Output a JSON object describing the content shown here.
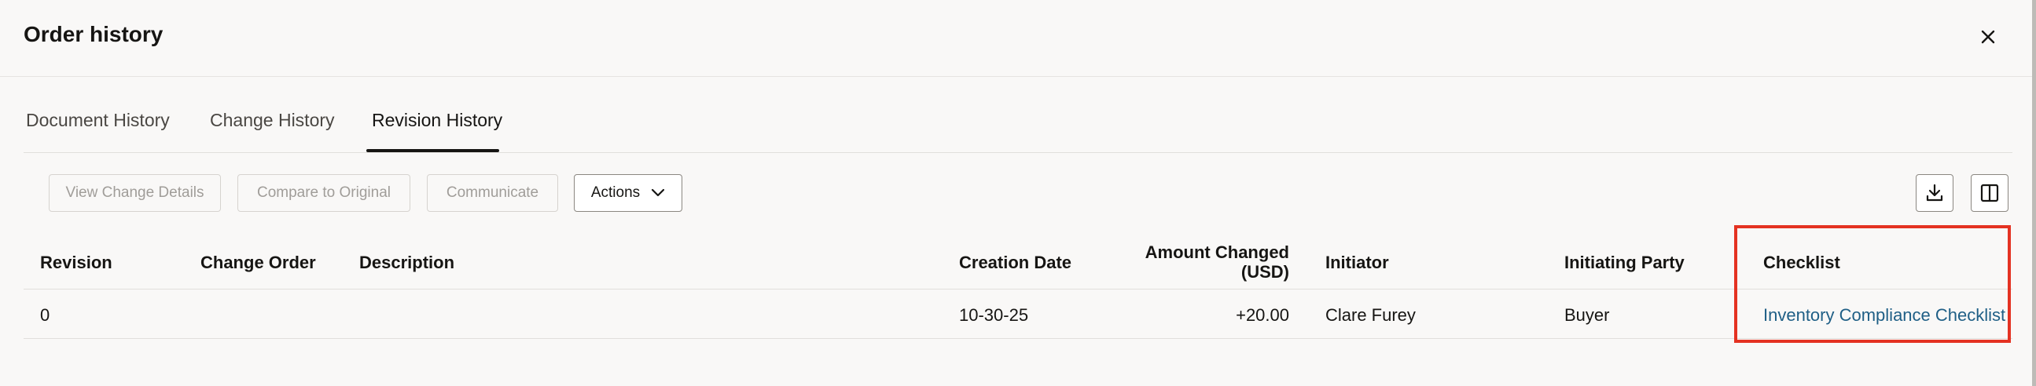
{
  "dialog": {
    "title": "Order history"
  },
  "tabs": [
    {
      "label": "Document History"
    },
    {
      "label": "Change History"
    },
    {
      "label": "Revision History",
      "active": true
    }
  ],
  "toolbar": {
    "view_change_details": "View Change Details",
    "compare_to_original": "Compare to Original",
    "communicate": "Communicate",
    "actions": "Actions"
  },
  "table": {
    "columns": {
      "revision": "Revision",
      "change_order": "Change Order",
      "description": "Description",
      "creation_date": "Creation Date",
      "amount_line1": "Amount Changed",
      "amount_line2": "(USD)",
      "initiator": "Initiator",
      "initiating_party": "Initiating Party",
      "checklist": "Checklist"
    },
    "rows": [
      {
        "revision": "0",
        "change_order": "",
        "description": "",
        "creation_date": "10-30-25",
        "amount_changed": "+20.00",
        "initiator": "Clare Furey",
        "initiating_party": "Buyer",
        "checklist": "Inventory Compliance Checklist"
      }
    ]
  },
  "colors": {
    "link": "#1f5f86",
    "highlight": "#e43222",
    "background": "#f9f8f7"
  },
  "icons": [
    "close-icon",
    "download-icon",
    "columns-icon",
    "chevron-down-icon"
  ]
}
